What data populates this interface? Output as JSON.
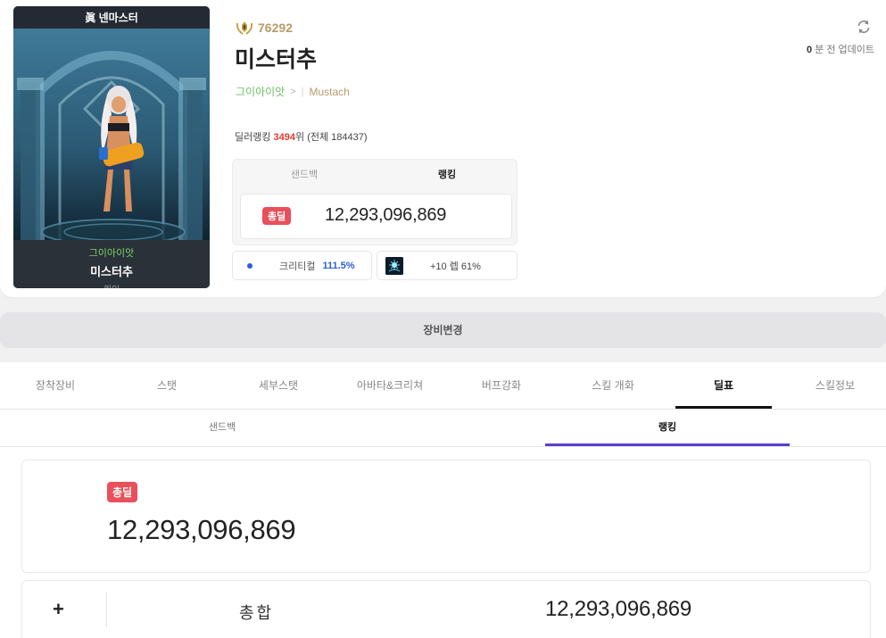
{
  "character_card": {
    "title": "眞 넨마스터",
    "adventure": "그이아이앗",
    "name": "미스터추",
    "job": "퀴인"
  },
  "profile": {
    "rank_number": "76292",
    "name": "미스터추",
    "adventure": "그이아이앗",
    "guild": "Mustach",
    "deal_rank_prefix": "딜러랭킹 ",
    "deal_rank_value": "3494",
    "deal_rank_suffix": "위 (전체 184437)",
    "update_num": "0",
    "update_text": "분 전 업데이트"
  },
  "damage_box": {
    "tabs": [
      "샌드백",
      "랭킹"
    ],
    "active_tab": "랭킹",
    "badge": "총딜",
    "value": "12,293,096,869"
  },
  "stats": {
    "crit_label": "크리티컬",
    "crit_value": "111.5%",
    "enchant_label": "+10 렙 61%"
  },
  "equip_change_label": "장비변경",
  "main_tabs": [
    "장착장비",
    "스탯",
    "세부스탯",
    "아바타&크리쳐",
    "버프강화",
    "스킬 개화",
    "딜표",
    "스킬정보"
  ],
  "main_active_tab": "딜표",
  "sub_tabs": [
    "샌드백",
    "랭킹"
  ],
  "sub_active_tab": "랭킹",
  "total": {
    "badge": "총딜",
    "value": "12,293,096,869"
  },
  "summary": {
    "expand": "+",
    "label": "총합",
    "value": "12,293,096,869"
  },
  "colors": {
    "accent_red": "#e8505b",
    "rank_red": "#e03a2c",
    "crit_blue": "#2a5fd8",
    "sub_tab_underline": "#5b3fd3",
    "adventure_green": "#6dbf64",
    "guild_gold": "#b79a6a"
  },
  "icons": {
    "rank": "laurel-crest-icon",
    "refresh": "refresh-icon",
    "crit": "dot-icon",
    "enchant": "enchant-item-icon"
  }
}
